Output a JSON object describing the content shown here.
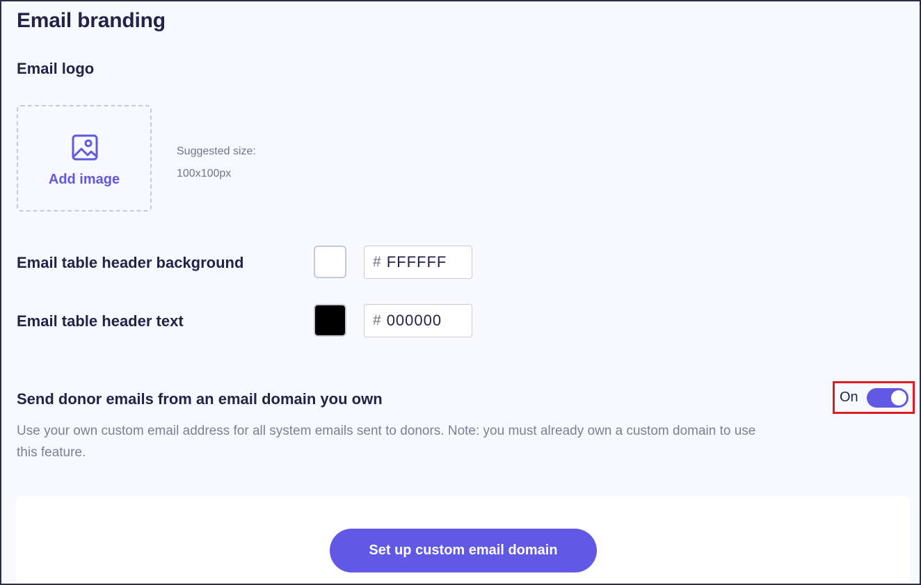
{
  "page": {
    "title": "Email branding"
  },
  "logo": {
    "section_title": "Email logo",
    "upload_label": "Add image",
    "upload_icon": "image-icon",
    "size_hint_label": "Suggested size:",
    "size_hint_value": "100x100px"
  },
  "header_background": {
    "label": "Email table header background",
    "hash": "#",
    "value": "FFFFFF",
    "swatch_color": "#FFFFFF"
  },
  "header_text": {
    "label": "Email table header text",
    "hash": "#",
    "value": "000000",
    "swatch_color": "#000000"
  },
  "custom_domain": {
    "title": "Send donor emails from an email domain you own",
    "description": "Use your own custom email address for all system emails sent to donors. Note: you must already own a custom domain to use this feature.",
    "toggle_state_label": "On",
    "toggle_on": true,
    "button_label": "Set up custom email domain"
  },
  "colors": {
    "accent": "#6158E6",
    "highlight_border": "#E11B22",
    "text_primary": "#23234A",
    "text_muted": "#7B7F93"
  }
}
